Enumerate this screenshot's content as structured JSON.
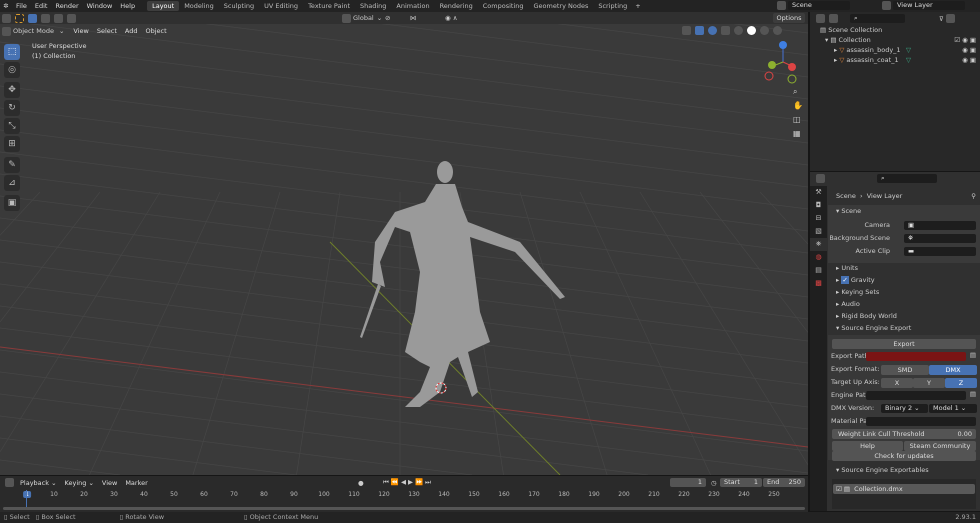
{
  "menu": [
    "File",
    "Edit",
    "Render",
    "Window",
    "Help"
  ],
  "workspaces": [
    "Layout",
    "Modeling",
    "Sculpting",
    "UV Editing",
    "Texture Paint",
    "Shading",
    "Animation",
    "Rendering",
    "Compositing",
    "Geometry Nodes",
    "Scripting"
  ],
  "active_workspace": "Layout",
  "scene_name": "Scene",
  "view_layer": "View Layer",
  "header": {
    "orientation": "Global",
    "options": "Options"
  },
  "viewport": {
    "mode": "Object Mode",
    "menus": [
      "View",
      "Select",
      "Add",
      "Object"
    ],
    "perspective": "User Perspective",
    "collection": "(1) Collection",
    "gizmo": {
      "z": "Z",
      "y": "Y",
      "x": "X"
    }
  },
  "outliner": {
    "root": "Scene Collection",
    "collection": "Collection",
    "objects": [
      "assassin_body_1",
      "assassin_coat_1"
    ]
  },
  "properties": {
    "breadcrumb": [
      "Scene",
      "View Layer"
    ],
    "scene_panel": "Scene",
    "camera_label": "Camera",
    "background_label": "Background Scene",
    "clip_label": "Active Clip",
    "panels": [
      "Units",
      "Gravity",
      "Keying Sets",
      "Audio",
      "Rigid Body World"
    ],
    "gravity_checked": true,
    "export_panel": "Source Engine Export",
    "export_button": "Export",
    "export_path_label": "Export Path:",
    "export_format_label": "Export Format:",
    "formats": [
      "SMD",
      "DMX"
    ],
    "active_format": "DMX",
    "up_axis_label": "Target Up Axis:",
    "axes": [
      "X",
      "Y",
      "Z"
    ],
    "active_axis": "Z",
    "engine_path_label": "Engine Path:",
    "dmx_version_label": "DMX Version:",
    "dmx_version": "Binary 2",
    "dmx_model": "Model 1",
    "material_path_label": "Material Path:",
    "cull_label": "Weight Link Cull Threshold",
    "cull_value": "0.00",
    "help": "Help",
    "steam": "Steam Community",
    "updates": "Check for updates",
    "exportables_panel": "Source Engine Exportables",
    "exportable_item": "Collection.dmx",
    "accent": "#4772b3",
    "export_path_color": "#7a1414"
  },
  "timeline": {
    "menus": [
      "Playback",
      "Keying",
      "View",
      "Marker"
    ],
    "current_frame": "1",
    "start_label": "Start",
    "start": "1",
    "end_label": "End",
    "end": "250",
    "ticks": [
      "1",
      "10",
      "20",
      "30",
      "40",
      "50",
      "60",
      "70",
      "80",
      "90",
      "100",
      "110",
      "120",
      "130",
      "140",
      "150",
      "160",
      "170",
      "180",
      "190",
      "200",
      "210",
      "220",
      "230",
      "240",
      "250"
    ]
  },
  "status": {
    "select": "Select",
    "box_select": "Box Select",
    "rotate": "Rotate View",
    "context": "Object Context Menu",
    "version": "2.93.1"
  }
}
